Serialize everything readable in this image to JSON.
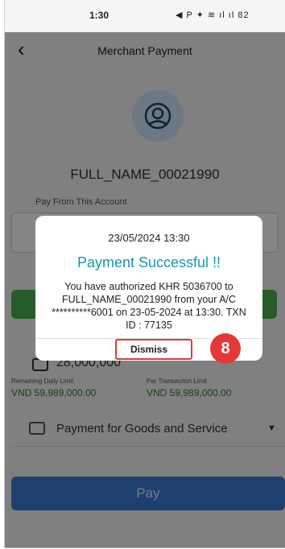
{
  "status_bar": {
    "time": "1:30",
    "icons": "◀ P    ✦ ≋ ıl ıl 82"
  },
  "header": {
    "back_icon": "chevron-left-icon",
    "title": "Merchant Payment"
  },
  "merchant": {
    "name": "FULL_NAME_00021990"
  },
  "form": {
    "pay_from_label": "Pay From This Account",
    "amount": "28,000,000",
    "remaining_daily_limit_label": "Remaining Daily Limit",
    "remaining_daily_limit_value": "VND 59,989,000.00",
    "per_transaction_limit_label": "Per Transaction Limit",
    "per_transaction_limit_value": "VND 59,989,000.00",
    "purpose": "Payment for Goods and Service",
    "pay_button": "Pay"
  },
  "dialog": {
    "datetime": "23/05/2024 13:30",
    "heading": "Payment Successful !!",
    "message": "You have authorized KHR 5036700 to FULL_NAME_00021990 from your A/C **********6001 on 23-05-2024 at 13:30. TXN ID : 77135",
    "dismiss": "Dismiss"
  },
  "annotation": {
    "step": "8"
  },
  "colors": {
    "accent": "#1798a8",
    "primary": "#3b7bd6",
    "highlight": "#e53935",
    "success_bar": "#4caf50"
  }
}
